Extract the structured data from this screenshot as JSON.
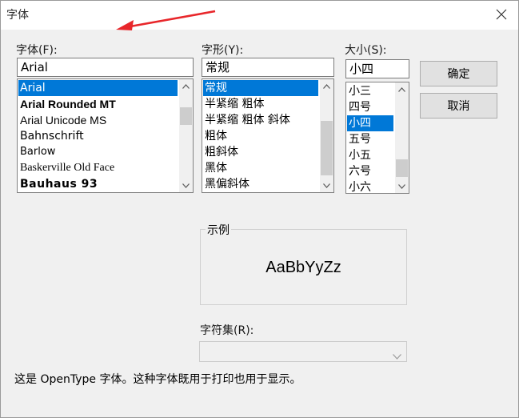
{
  "window": {
    "title": "字体"
  },
  "font": {
    "label": "字体(F):",
    "value": "Arial",
    "items": [
      "Arial",
      "Arial Rounded MT",
      "Arial Unicode MS",
      "Bahnschrift",
      "Barlow",
      "Baskerville Old Face",
      "Bauhaus 93"
    ],
    "selected_index": 0
  },
  "style": {
    "label": "字形(Y):",
    "value": "常规",
    "items": [
      "常规",
      "半紧缩 粗体",
      "半紧缩 粗体 斜体",
      "粗体",
      "粗斜体",
      "黑体",
      "黑偏斜体"
    ],
    "selected_index": 0
  },
  "size": {
    "label": "大小(S):",
    "value": "小四",
    "items": [
      "小三",
      "四号",
      "小四",
      "五号",
      "小五",
      "六号",
      "小六"
    ],
    "selected_index": 2
  },
  "buttons": {
    "ok": "确定",
    "cancel": "取消"
  },
  "sample": {
    "label": "示例",
    "text": "AaBbYyZz"
  },
  "charset": {
    "label": "字符集(R):",
    "value": ""
  },
  "description": "这是 OpenType 字体。这种字体既用于打印也用于显示。",
  "colors": {
    "selection": "#0078d7",
    "annotation_arrow": "#e8262a"
  },
  "icons": [
    "close-icon",
    "scroll-up-icon",
    "scroll-down-icon",
    "dropdown-arrow-icon",
    "annotation-arrow"
  ]
}
